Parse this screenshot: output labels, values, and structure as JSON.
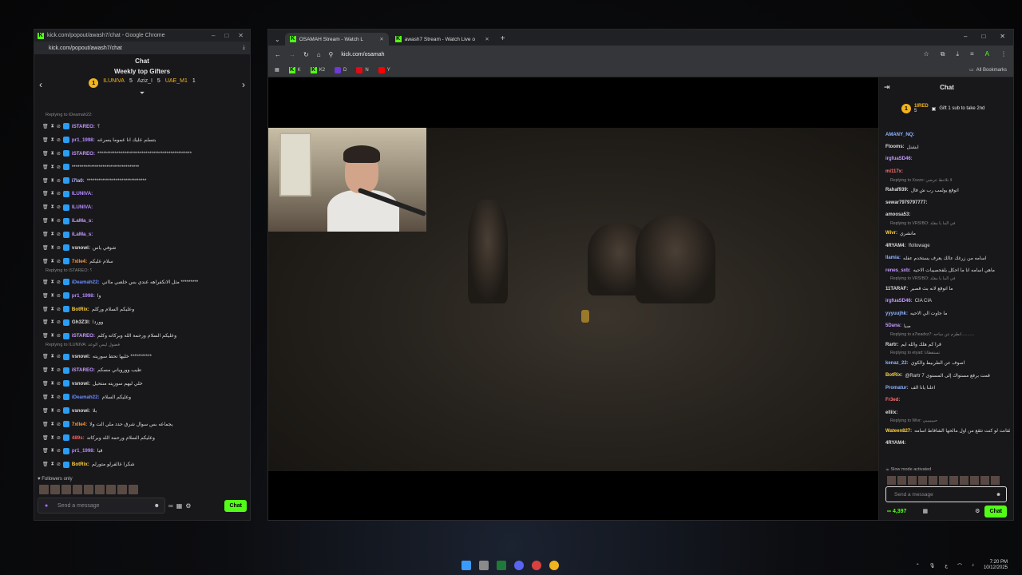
{
  "popup": {
    "window_title": "kick.com/popout/awash7/chat - Google Chrome",
    "url": "kick.com/popout/awash7/chat",
    "chat_title": "Chat",
    "gifters_title": "Weekly top Gifters",
    "gifters": [
      {
        "rank": "1",
        "name": "ILUNIVA",
        "count": "5"
      },
      {
        "name": "Aziz_I",
        "count": "5"
      },
      {
        "name": "UAE_M1",
        "count": "1"
      }
    ],
    "messages": [
      {
        "reply": "Replying to iDeamah22:",
        "user": "iSTAREO:",
        "color": "#c79bff",
        "text": "؟"
      },
      {
        "user": "pr1_1998:",
        "color": "#b48cff",
        "text": "بتسلم عليك انا عموما يسرعه"
      },
      {
        "user": "iSTAREO:",
        "color": "#c79bff",
        "text": "*************************************************"
      },
      {
        "user": "",
        "color": "#ccc",
        "text": "***********************************"
      },
      {
        "user": "i7la0:",
        "color": "#b8b8ff",
        "text": "*******************************"
      },
      {
        "user": "ILUNIVA:",
        "color": "#b48cff",
        "text": ""
      },
      {
        "user": "ILUNIVA:",
        "color": "#b48cff",
        "text": ""
      },
      {
        "user": "iLaMa_s:",
        "color": "#c79bff",
        "text": ""
      },
      {
        "user": "iLaMa_s:",
        "color": "#c79bff",
        "text": ""
      },
      {
        "user": "vsnowi:",
        "color": "#ddd",
        "text": "شوفي ياس"
      },
      {
        "user": "7xlle4:",
        "color": "#ff9a3c",
        "text": "سلام عليكم"
      },
      {
        "reply": "Replying to iSTAREO: ؟",
        "user": "iDeamah22:",
        "color": "#6a8cff",
        "text": "مثل الانكفراهه عندي بس خلصي مااني *********"
      },
      {
        "user": "pr1_1998:",
        "color": "#b48cff",
        "text": "وا"
      },
      {
        "user": "BotRix:",
        "color": "#ffd23c",
        "text": "وعليكم السلام وركلم"
      },
      {
        "user": "Gh3Z3l:",
        "color": "#ddd",
        "text": "ووردا"
      },
      {
        "user": "iSTAREO:",
        "color": "#c79bff",
        "text": "وعليكم السلام ورحمة الله وبركاته وكلم"
      },
      {
        "reply": "Replying to ILUNIVA: فضول ليس الوعد",
        "user": "vsnowi:",
        "color": "#ddd",
        "text": "خليها تحط سوريته ***********"
      },
      {
        "user": "iSTAREO:",
        "color": "#c79bff",
        "text": "طيب ووروباني مسكم"
      },
      {
        "user": "vsnowi:",
        "color": "#ddd",
        "text": "خلي ليهم سوريته منتحيل"
      },
      {
        "user": "iDeamah22:",
        "color": "#6a8cff",
        "text": "وعليكم السلام"
      },
      {
        "user": "vsnowi:",
        "color": "#ddd",
        "text": "بلا"
      },
      {
        "user": "7xlle4:",
        "color": "#ff9a3c",
        "text": "يجماعه بس سوال شرق حدد ملي الت ولا"
      },
      {
        "user": "489s:",
        "color": "#ff5c5c",
        "text": "وعليكم السلام ورحمة الله وبركاته"
      },
      {
        "user": "pr1_1998:",
        "color": "#b48cff",
        "text": "قيا"
      },
      {
        "user": "BotRix:",
        "color": "#ffd23c",
        "text": "شكرا عالفرلو متورلم"
      }
    ],
    "followers_label": "Followers only",
    "input_placeholder": "Send a message",
    "chat_button": "Chat"
  },
  "browser": {
    "tabs": [
      {
        "label": "OSAMAH Stream - Watch L",
        "active": true
      },
      {
        "label": "awash7 Stream - Watch Live o",
        "active": false
      }
    ],
    "url": "kick.com/osamah",
    "bookmarks": [
      "K",
      "K2",
      "D",
      "N",
      "Y"
    ],
    "all_bookmarks": "All Bookmarks"
  },
  "stream_chat": {
    "title": "Chat",
    "pinned_user": "1IRED",
    "pinned_count": "5",
    "pinned_text": "Gift 1 sub to take 2nd",
    "messages": [
      {
        "user": "AMANY_NQ:",
        "color": "#8fb4ff",
        "text": ""
      },
      {
        "user": "Ftooms:",
        "color": "#ddd",
        "text": "ابشنل"
      },
      {
        "user": "irgfuaSD46:",
        "color": "#c79bff",
        "text": ""
      },
      {
        "user": "mi117x:",
        "color": "#ff7070",
        "text": ""
      },
      {
        "reply": "Replying to Xxzzo: لا تلاحظ عرضي",
        "user": "Rahaf939:",
        "color": "#ddd",
        "text": "اتوقع يولمب رب ش فال"
      },
      {
        "user": "sewar7979797777:",
        "color": "#ddd",
        "text": ""
      },
      {
        "user": "amoosa53:",
        "color": "#ddd",
        "text": ""
      },
      {
        "reply": "Replying to VRS!BO: في الما يا مقلد",
        "user": "Wivr:",
        "color": "#ffd23c",
        "text": "مانشري"
      },
      {
        "user": "4RYAM4:",
        "color": "#ddd",
        "text": "!followage"
      },
      {
        "user": "llamia:",
        "color": "#8fb4ff",
        "text": "اسامه من زرغك عالك يعرف يستخدم عفله"
      },
      {
        "user": "renes_sxb:",
        "color": "#c79bff",
        "text": "ماهي اسامه انا ما احكل بلفحصيبات الاحيه"
      },
      {
        "reply": "Replying to VRS!BO: في الما يا مقلد",
        "user": "11TARAF:",
        "color": "#ddd",
        "text": "ما اتوقع لانه بث قصير"
      },
      {
        "user": "irgfuaSD46:",
        "color": "#c79bff",
        "text": "CIA CIA"
      },
      {
        "user": "yyyuujhk:",
        "color": "#8fb4ff",
        "text": "ما جاوت الي الاحيه"
      },
      {
        "user": "5Dana:",
        "color": "#c79bff",
        "text": "صبا"
      },
      {
        "reply": "Replying to a7teadxz7: انطرم عن ساحه...........",
        "user": "Rartr:",
        "color": "#ddd",
        "text": "قرا كم هلك والله ايم"
      },
      {
        "reply": "Replying to etyad: تستقطانا",
        "user": "kenaz_22:",
        "color": "#8fb4ff",
        "text": "اصوف عن الطربيط والكوي"
      },
      {
        "user": "BotRix:",
        "color": "#ffd23c",
        "text": "@Rartr 7 قمت برفع مستواك إلى المستوى"
      },
      {
        "user": "Promatur:",
        "color": "#8fb4ff",
        "text": "اعلنا يانا الف"
      },
      {
        "user": "Fr3ed:",
        "color": "#ff7070",
        "text": ""
      },
      {
        "user": "elliix:",
        "color": "#ddd",
        "text": ""
      },
      {
        "reply": "Replying to Wivr: حبيبيبيبي",
        "user": "Wateen827:",
        "color": "#ffd23c",
        "text": "بلقانت لو كنت تثقع من اول مالحها الشافاط اسامه"
      },
      {
        "user": "4RYAM4:",
        "color": "#ddd",
        "text": ""
      }
    ],
    "slow_mode": "Slow mode activated",
    "input_placeholder": "Send a message",
    "kicks": "4,397",
    "chat_button": "Chat"
  },
  "taskbar": {
    "time": "7:20 PM",
    "date": "10/12/2025",
    "lang": "ع"
  }
}
